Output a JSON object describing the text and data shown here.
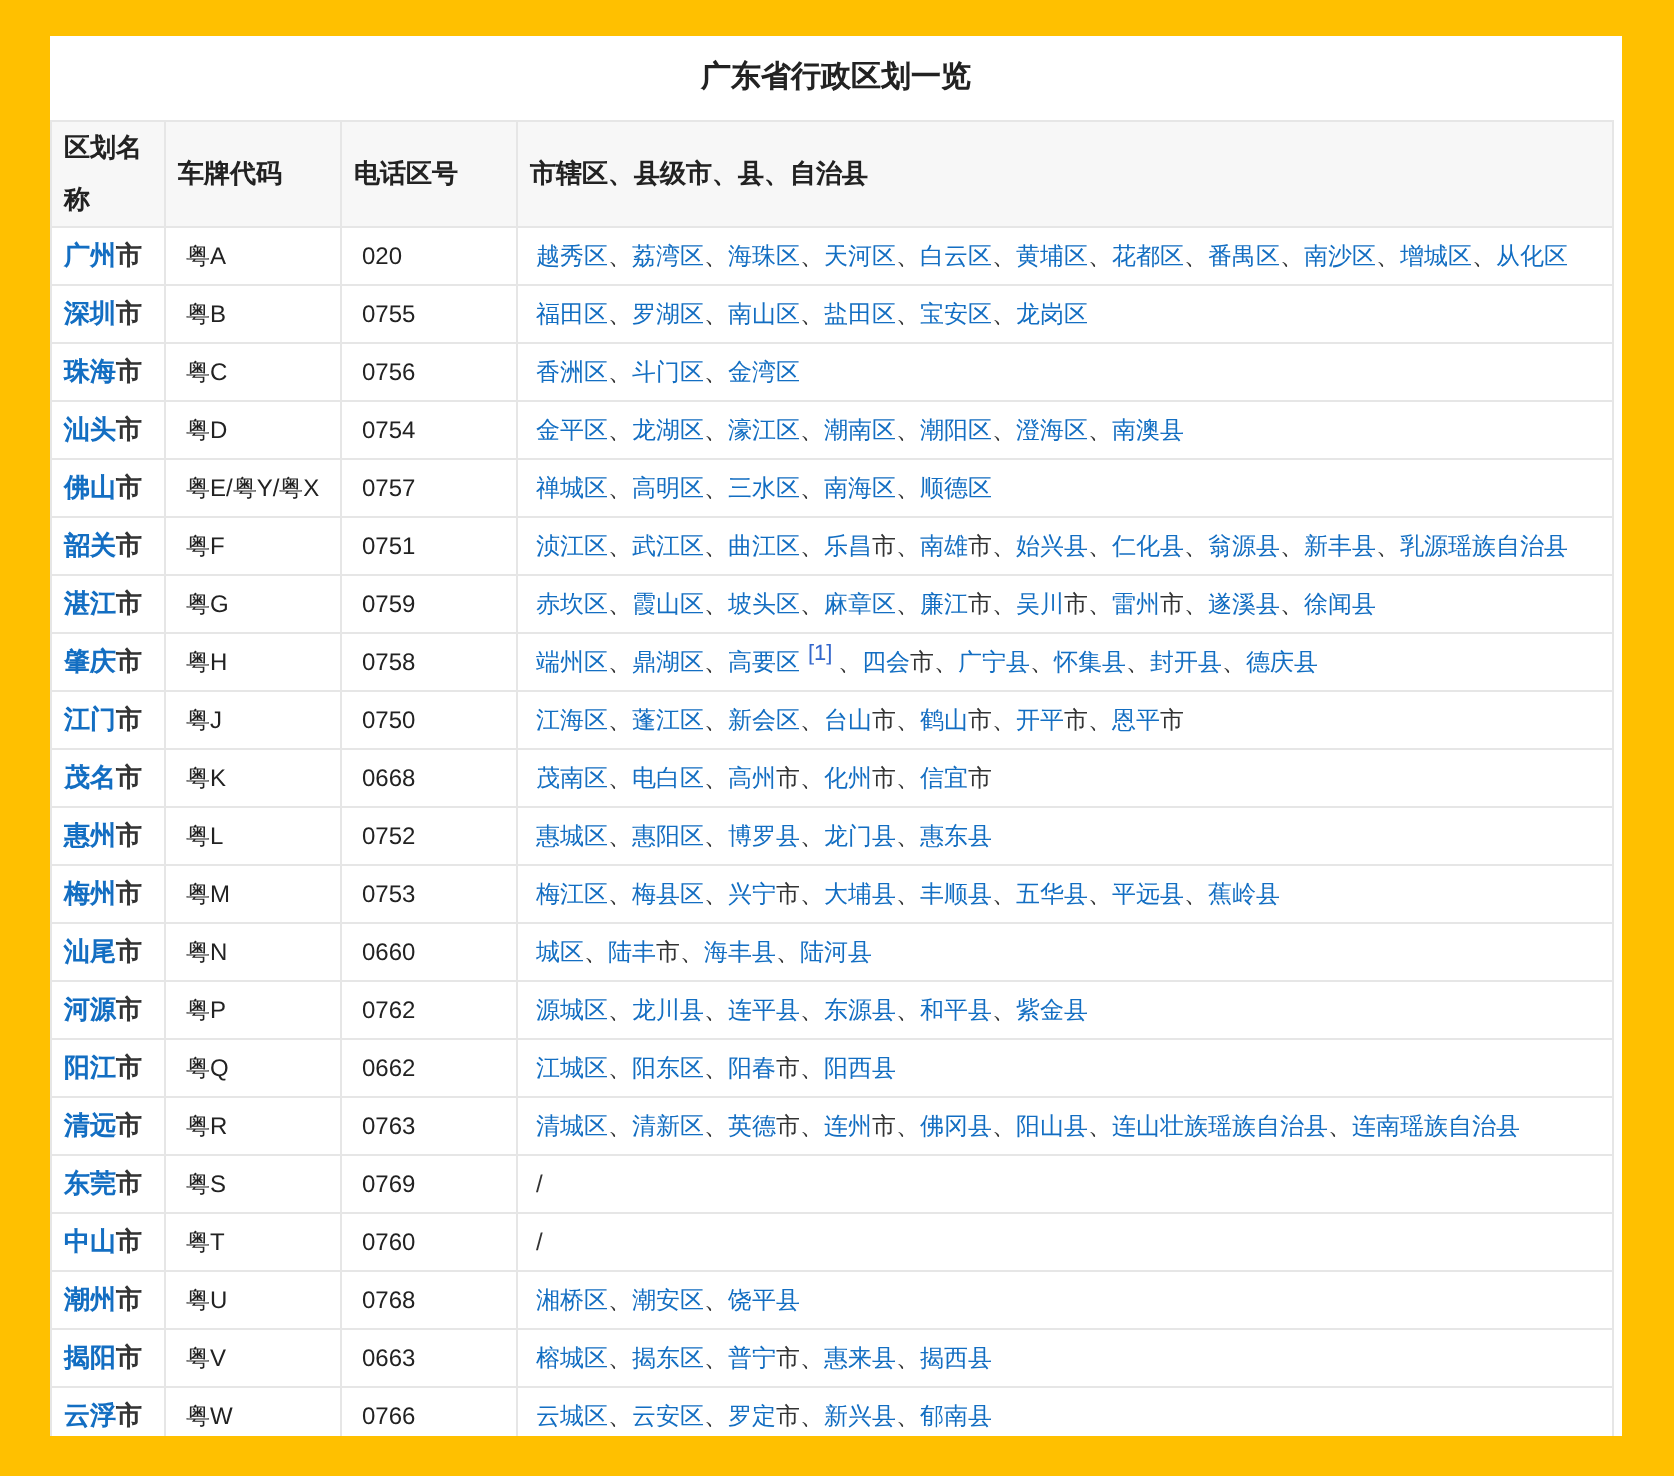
{
  "title": "广东省行政区划一览",
  "separator": "、",
  "columns": [
    "区划名称",
    "车牌代码",
    "电话区号",
    "市辖区、县级市、县、自治县"
  ],
  "rows": [
    {
      "city": {
        "text": "广州",
        "suffix": "市"
      },
      "plate": "粤A",
      "phone": "020",
      "districts": [
        {
          "text": "越秀区"
        },
        {
          "text": "荔湾区"
        },
        {
          "text": "海珠区"
        },
        {
          "text": "天河区"
        },
        {
          "text": "白云区"
        },
        {
          "text": "黄埔区"
        },
        {
          "text": "花都区"
        },
        {
          "text": "番禺区"
        },
        {
          "text": "南沙区"
        },
        {
          "text": "增城区"
        },
        {
          "text": "从化区"
        }
      ]
    },
    {
      "city": {
        "text": "深圳",
        "suffix": "市"
      },
      "plate": "粤B",
      "phone": "0755",
      "districts": [
        {
          "text": "福田区"
        },
        {
          "text": "罗湖区"
        },
        {
          "text": "南山区"
        },
        {
          "text": "盐田区"
        },
        {
          "text": "宝安区"
        },
        {
          "text": "龙岗区"
        }
      ]
    },
    {
      "city": {
        "text": "珠海",
        "suffix": "市"
      },
      "plate": "粤C",
      "phone": "0756",
      "districts": [
        {
          "text": "香洲区"
        },
        {
          "text": "斗门区"
        },
        {
          "text": "金湾区"
        }
      ]
    },
    {
      "city": {
        "text": "汕头",
        "suffix": "市"
      },
      "plate": "粤D",
      "phone": "0754",
      "districts": [
        {
          "text": "金平区"
        },
        {
          "text": "龙湖区"
        },
        {
          "text": "濠江区"
        },
        {
          "text": "潮南区"
        },
        {
          "text": "潮阳区"
        },
        {
          "text": "澄海区"
        },
        {
          "text": "南澳县"
        }
      ]
    },
    {
      "city": {
        "text": "佛山",
        "suffix": "市"
      },
      "plate": "粤E/粤Y/粤X",
      "phone": "0757",
      "districts": [
        {
          "text": "禅城区"
        },
        {
          "text": "高明区"
        },
        {
          "text": "三水区"
        },
        {
          "text": "南海区"
        },
        {
          "text": "顺德区"
        }
      ]
    },
    {
      "city": {
        "text": "韶关",
        "suffix": "市"
      },
      "plate": "粤F",
      "phone": "0751",
      "districts": [
        {
          "text": "浈江区"
        },
        {
          "text": "武江区"
        },
        {
          "text": "曲江区"
        },
        {
          "text": "乐昌",
          "suffix": "市"
        },
        {
          "text": "南雄",
          "suffix": "市"
        },
        {
          "text": "始兴县"
        },
        {
          "text": "仁化县"
        },
        {
          "text": "翁源县"
        },
        {
          "text": "新丰县"
        },
        {
          "text": "乳源瑶族自治县"
        }
      ]
    },
    {
      "city": {
        "text": "湛江",
        "suffix": "市"
      },
      "plate": "粤G",
      "phone": "0759",
      "districts": [
        {
          "text": "赤坎区"
        },
        {
          "text": "霞山区"
        },
        {
          "text": "坡头区"
        },
        {
          "text": "麻章区"
        },
        {
          "text": "廉江",
          "suffix": "市"
        },
        {
          "text": "吴川",
          "suffix": "市"
        },
        {
          "text": "雷州",
          "suffix": "市"
        },
        {
          "text": "遂溪县"
        },
        {
          "text": "徐闻县"
        }
      ]
    },
    {
      "city": {
        "text": "肇庆",
        "suffix": "市"
      },
      "plate": "粤H",
      "phone": "0758",
      "districts": [
        {
          "text": "端州区"
        },
        {
          "text": "鼎湖区"
        },
        {
          "text": "高要区",
          "note": "[1]"
        },
        {
          "text": "四会",
          "suffix": "市"
        },
        {
          "text": "广宁县"
        },
        {
          "text": "怀集县"
        },
        {
          "text": "封开县"
        },
        {
          "text": "德庆县"
        }
      ]
    },
    {
      "city": {
        "text": "江门",
        "suffix": "市"
      },
      "plate": "粤J",
      "phone": "0750",
      "districts": [
        {
          "text": "江海区"
        },
        {
          "text": "蓬江区"
        },
        {
          "text": "新会区"
        },
        {
          "text": "台山",
          "suffix": "市"
        },
        {
          "text": "鹤山",
          "suffix": "市"
        },
        {
          "text": "开平",
          "suffix": "市"
        },
        {
          "text": "恩平",
          "suffix": "市"
        }
      ]
    },
    {
      "city": {
        "text": "茂名",
        "suffix": "市"
      },
      "plate": "粤K",
      "phone": "0668",
      "districts": [
        {
          "text": "茂南区"
        },
        {
          "text": "电白区"
        },
        {
          "text": "高州",
          "suffix": "市"
        },
        {
          "text": "化州",
          "suffix": "市"
        },
        {
          "text": "信宜",
          "suffix": "市"
        }
      ]
    },
    {
      "city": {
        "text": "惠州",
        "suffix": "市"
      },
      "plate": "粤L",
      "phone": "0752",
      "districts": [
        {
          "text": "惠城区"
        },
        {
          "text": "惠阳区"
        },
        {
          "text": "博罗县"
        },
        {
          "text": "龙门县"
        },
        {
          "text": "惠东县"
        }
      ]
    },
    {
      "city": {
        "text": "梅州",
        "suffix": "市"
      },
      "plate": "粤M",
      "phone": "0753",
      "districts": [
        {
          "text": "梅江区"
        },
        {
          "text": "梅县区"
        },
        {
          "text": "兴宁",
          "suffix": "市"
        },
        {
          "text": "大埔县"
        },
        {
          "text": "丰顺县"
        },
        {
          "text": "五华县"
        },
        {
          "text": "平远县"
        },
        {
          "text": "蕉岭县"
        }
      ]
    },
    {
      "city": {
        "text": "汕尾",
        "suffix": "市"
      },
      "plate": "粤N",
      "phone": "0660",
      "districts": [
        {
          "text": "城区"
        },
        {
          "text": "陆丰",
          "suffix": "市"
        },
        {
          "text": "海丰县"
        },
        {
          "text": "陆河县"
        }
      ]
    },
    {
      "city": {
        "text": "河源",
        "suffix": "市"
      },
      "plate": "粤P",
      "phone": "0762",
      "districts": [
        {
          "text": "源城区"
        },
        {
          "text": "龙川县"
        },
        {
          "text": "连平县"
        },
        {
          "text": "东源县"
        },
        {
          "text": "和平县"
        },
        {
          "text": "紫金县"
        }
      ]
    },
    {
      "city": {
        "text": "阳江",
        "suffix": "市"
      },
      "plate": "粤Q",
      "phone": "0662",
      "districts": [
        {
          "text": "江城区"
        },
        {
          "text": "阳东区"
        },
        {
          "text": "阳春",
          "suffix": "市"
        },
        {
          "text": "阳西县"
        }
      ]
    },
    {
      "city": {
        "text": "清远",
        "suffix": "市"
      },
      "plate": "粤R",
      "phone": "0763",
      "districts": [
        {
          "text": "清城区"
        },
        {
          "text": "清新区"
        },
        {
          "text": "英德",
          "suffix": "市"
        },
        {
          "text": "连州",
          "suffix": "市"
        },
        {
          "text": "佛冈县"
        },
        {
          "text": "阳山县"
        },
        {
          "text": "连山壮族瑶族自治县"
        },
        {
          "text": "连南瑶族自治县"
        }
      ]
    },
    {
      "city": {
        "text": "东莞",
        "suffix": "市"
      },
      "plate": "粤S",
      "phone": "0769",
      "none": "/"
    },
    {
      "city": {
        "text": "中山",
        "suffix": "市"
      },
      "plate": "粤T",
      "phone": "0760",
      "none": "/"
    },
    {
      "city": {
        "text": "潮州",
        "suffix": "市"
      },
      "plate": "粤U",
      "phone": "0768",
      "districts": [
        {
          "text": "湘桥区"
        },
        {
          "text": "潮安区"
        },
        {
          "text": "饶平县"
        }
      ]
    },
    {
      "city": {
        "text": "揭阳",
        "suffix": "市"
      },
      "plate": "粤V",
      "phone": "0663",
      "districts": [
        {
          "text": "榕城区"
        },
        {
          "text": "揭东区"
        },
        {
          "text": "普宁",
          "suffix": "市"
        },
        {
          "text": "惠来县"
        },
        {
          "text": "揭西县"
        }
      ]
    },
    {
      "city": {
        "text": "云浮",
        "suffix": "市"
      },
      "plate": "粤W",
      "phone": "0766",
      "districts": [
        {
          "text": "云城区"
        },
        {
          "text": "云安区"
        },
        {
          "text": "罗定",
          "suffix": "市"
        },
        {
          "text": "新兴县"
        },
        {
          "text": "郁南县"
        }
      ]
    }
  ]
}
